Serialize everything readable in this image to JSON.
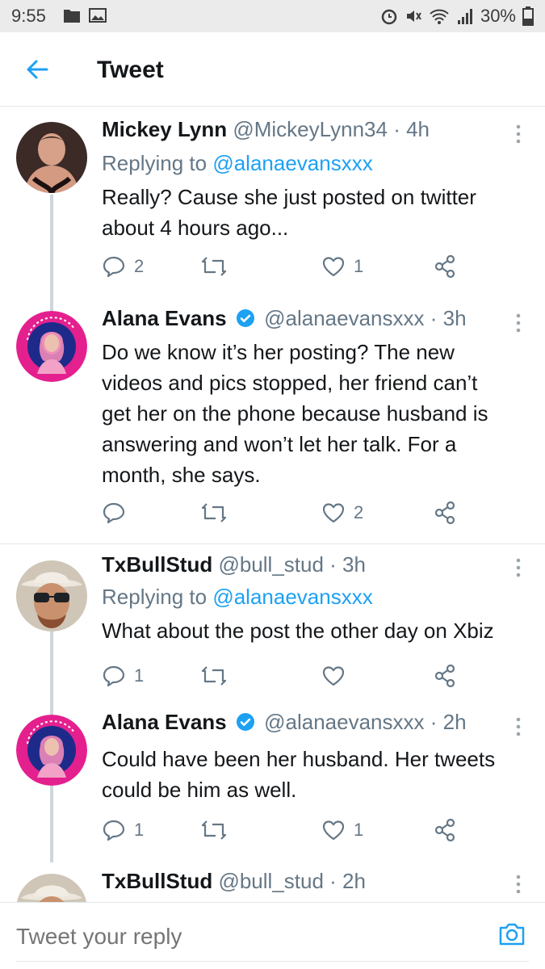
{
  "status_bar": {
    "time": "9:55",
    "battery": "30%"
  },
  "header": {
    "title": "Tweet"
  },
  "tweets": [
    {
      "name": "Mickey Lynn",
      "handle": "@MickeyLynn34",
      "time": "· 4h",
      "replying_label": "Replying to",
      "replying_to": "@alanaevansxxx",
      "text_lines": [
        "Really? Cause she just posted on twitter",
        "about 4 hours ago..."
      ],
      "replies": "2",
      "retweets": "",
      "likes": "1"
    },
    {
      "name": "Alana Evans",
      "handle": "@alanaevansxxx",
      "time": "· 3h",
      "text_lines": [
        "Do we know it’s her posting? The new",
        "videos and pics stopped, her friend can’t",
        "get her on the phone because husband is",
        "answering and won’t let her talk.  For a",
        "month, she says."
      ],
      "replies": "",
      "retweets": "",
      "likes": "2"
    },
    {
      "name": "TxBullStud",
      "handle": "@bull_stud",
      "time": "· 3h",
      "replying_label": "Replying to",
      "replying_to": "@alanaevansxxx",
      "text_lines": [
        "What about the post the other day on Xbiz"
      ],
      "replies": "1",
      "retweets": "",
      "likes": ""
    },
    {
      "name": "Alana Evans",
      "handle": "@alanaevansxxx",
      "time": "· 2h",
      "text_lines": [
        "Could have been her husband. Her tweets",
        "could be him as well."
      ],
      "replies": "1",
      "retweets": "",
      "likes": "1"
    },
    {
      "name": "TxBullStud",
      "handle": "@bull_stud",
      "time": "· 2h"
    }
  ],
  "avatar_badge_text": "I SUPPORT ELIZA",
  "reply_bar": {
    "placeholder": "Tweet your reply"
  },
  "colors": {
    "accent": "#1da1f2",
    "secondary_text": "#657786",
    "primary_text": "#14171a",
    "divider": "#e1e8ed"
  },
  "icons": {
    "back": "arrow-left-icon",
    "more": "more-vertical-icon",
    "reply": "reply-icon",
    "retweet": "retweet-icon",
    "like": "heart-icon",
    "share": "share-icon",
    "verified": "verified-badge-icon",
    "camera": "camera-icon"
  }
}
